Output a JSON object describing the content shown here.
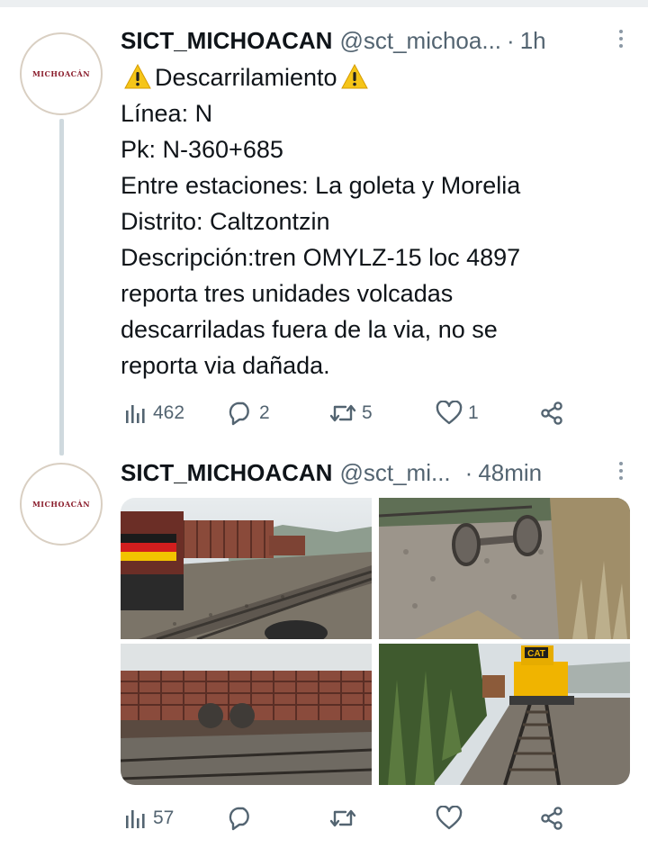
{
  "tweets": [
    {
      "avatar_text": "MICHOACÁN",
      "name": "SICT_MICHOACAN",
      "handle": "@sct_michoa...",
      "separator": "·",
      "time": "1h",
      "lines": [
        "Descarrilamiento",
        "Línea: N",
        "Pk: N-360+685",
        "Entre estaciones: La goleta y Morelia",
        "Distrito: Caltzontzin",
        "Descripción:tren OMYLZ-15 loc 4897",
        "reporta tres unidades volcadas",
        "descarriladas fuera de la via, no se",
        "reporta via dañada."
      ],
      "stats": {
        "views": "462",
        "replies": "2",
        "retweets": "5",
        "likes": "1"
      }
    },
    {
      "avatar_text": "MICHOACÁN",
      "name": "SICT_MICHOACAN",
      "handle": "@sct_mi...",
      "separator": "·",
      "time": "48min",
      "stats": {
        "views": "57"
      },
      "photos_logo_text": "CAT"
    }
  ],
  "colors": {
    "text": "#0f1419",
    "muted": "#536471",
    "thread": "#cfd9de",
    "warning": "#f5c518",
    "brand": "#8a1c2b"
  },
  "icons": [
    "views-icon",
    "reply-icon",
    "retweet-icon",
    "like-icon",
    "share-icon",
    "warning-icon",
    "more-icon"
  ]
}
